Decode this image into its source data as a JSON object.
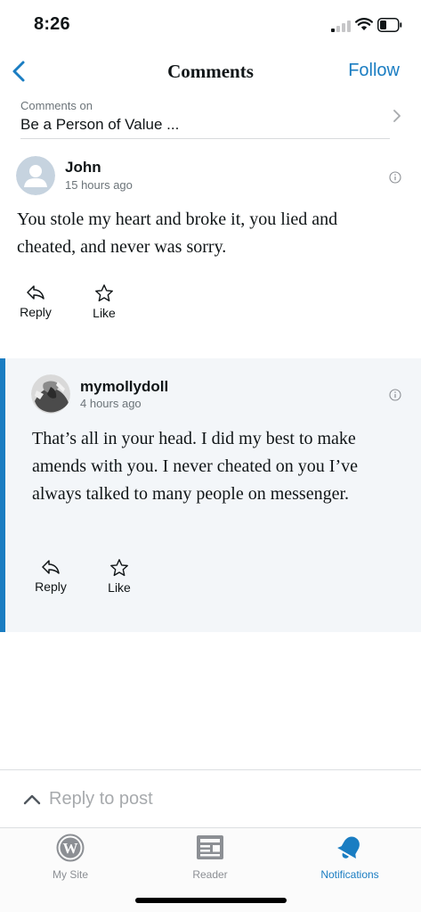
{
  "status_bar": {
    "time": "8:26"
  },
  "nav": {
    "title": "Comments",
    "follow_label": "Follow"
  },
  "post": {
    "label": "Comments on",
    "title": "Be a Person of Value ..."
  },
  "comments": [
    {
      "author": "John",
      "time": "15 hours ago",
      "text": "You stole my heart and broke it, you lied and cheated, and never was sorry.",
      "reply_label": "Reply",
      "like_label": "Like"
    },
    {
      "author": "mymollydoll",
      "time": "4 hours ago",
      "text": "That’s all in your head. I did my best to make amends with you. I never cheated on you I’ve always talked to many people on messenger.",
      "reply_label": "Reply",
      "like_label": "Like"
    }
  ],
  "reply_field": {
    "placeholder": "Reply to post"
  },
  "tabs": [
    {
      "label": "My Site",
      "icon": "wordpress-icon",
      "active": false
    },
    {
      "label": "Reader",
      "icon": "reader-icon",
      "active": false
    },
    {
      "label": "Notifications",
      "icon": "bell-icon",
      "active": true
    }
  ],
  "colors": {
    "accent": "#1a7dc2",
    "reply_background": "#f3f6f9",
    "muted_text": "#6c7479"
  }
}
